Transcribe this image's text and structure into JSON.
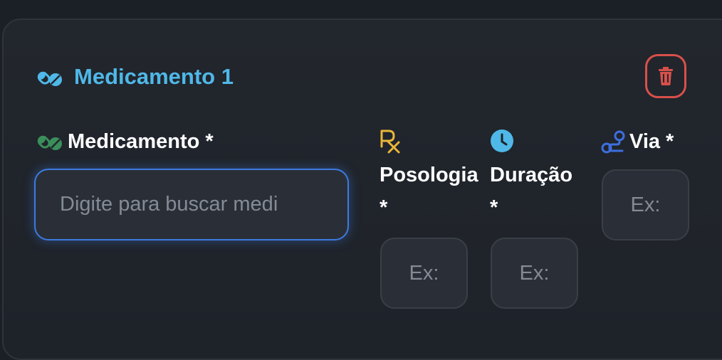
{
  "card": {
    "title": "Medicamento 1",
    "title_color": "#4fb8e8",
    "delete_color": "#d8504a"
  },
  "fields": {
    "medicamento": {
      "label": "Medicamento *",
      "placeholder": "Digite para buscar medi",
      "icon": "pills-icon",
      "icon_color": "#3a8f5a"
    },
    "posologia": {
      "label_line1": "Posologia",
      "label_line2": "*",
      "placeholder": "Ex:",
      "icon": "prescription-icon",
      "icon_color": "#e8b73a"
    },
    "duracao": {
      "label_line1": "Duração",
      "label_line2": "*",
      "placeholder": "Ex:",
      "icon": "clock-icon",
      "icon_color": "#4fb8e8"
    },
    "via": {
      "label": "Via *",
      "placeholder": "Ex:",
      "icon": "route-icon",
      "icon_color": "#3d6fe0"
    }
  }
}
